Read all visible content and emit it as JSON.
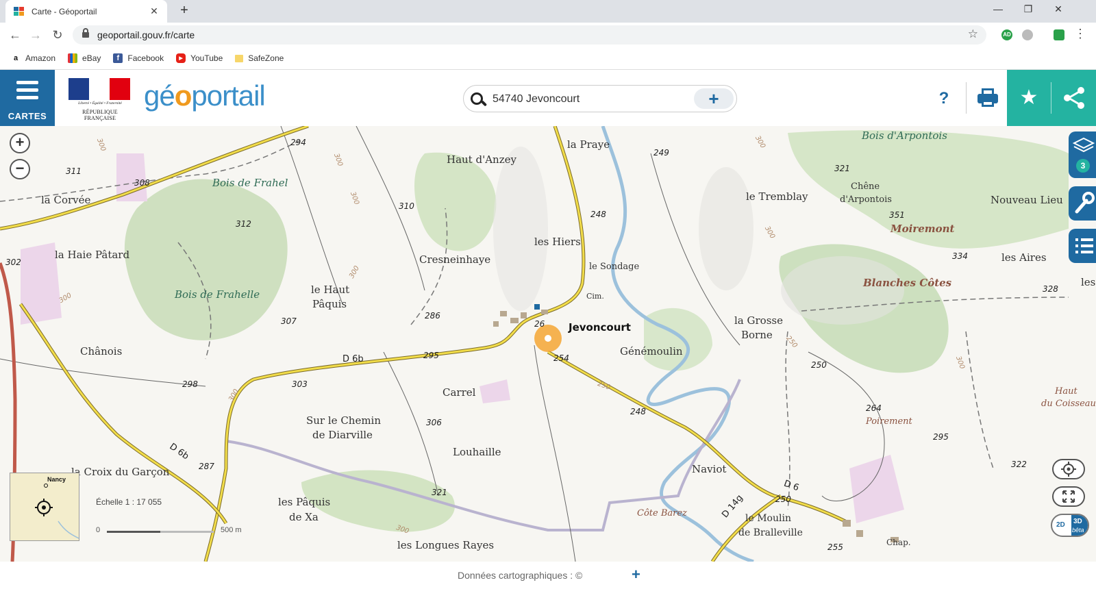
{
  "browser": {
    "tab_title": "Carte - Géoportail",
    "tab_close": "✕",
    "new_tab": "+",
    "url": "geoportail.gouv.fr/carte",
    "window_controls": {
      "minimize": "—",
      "maximize": "❐",
      "close": "✕"
    },
    "extensions": [
      "AD",
      "",
      ""
    ],
    "bookmarks": [
      {
        "label": "Amazon",
        "icon": "amazon-icon"
      },
      {
        "label": "eBay",
        "icon": "ebay-icon"
      },
      {
        "label": "Facebook",
        "icon": "facebook-icon"
      },
      {
        "label": "YouTube",
        "icon": "youtube-icon"
      },
      {
        "label": "SafeZone",
        "icon": "folder-icon"
      }
    ]
  },
  "header": {
    "menu_label": "CARTES",
    "rf_motto": "Liberté • Égalité • Fraternité",
    "rf_name": "RÉPUBLIQUE FRANÇAISE",
    "logo": {
      "part1": "gé",
      "part2": "o",
      "part3": "portail"
    },
    "search_value": "54740 Jevoncourt",
    "search_add": "+",
    "help": "?",
    "colors": {
      "primary": "#1f6aa1",
      "accent": "#24b3a1",
      "logo_orange": "#f09a1e"
    }
  },
  "map": {
    "zoom_in": "+",
    "zoom_out": "−",
    "layers_count": "3",
    "minimap_label": "Nancy",
    "scale_text": "Échelle 1 : 17 055",
    "scale_min": "0",
    "scale_max": "500 m",
    "btn_2d": "2D",
    "btn_3d": "3D",
    "btn_beta": "bêta",
    "labels": {
      "places": [
        "la Praye",
        "Haut d'Anzey",
        "la Corvée",
        "la Haie Pâtard",
        "Cresneinhaye",
        "les Hiers",
        "le Sondage",
        "le Haut",
        "Pâquis",
        "Chânois",
        "Carrel",
        "Génémoulin",
        "la Grosse",
        "Borne",
        "le Tremblay",
        "Chêne",
        "d'Arpontois",
        "Nouveau Lieu",
        "les Aires",
        "les",
        "Sur le Chemin",
        "de Diarville",
        "Louhaille",
        "la Croix du Garçon",
        "les Pâquis",
        "de Xa",
        "les Longues Rayes",
        "Naviot",
        "le Moulin",
        "de Bralleville",
        "Cim.",
        "Chap."
      ],
      "town": "Jevoncourt",
      "forests": [
        "Bois de Frahel",
        "Bois de Frahelle",
        "Bois d'Arpontois"
      ],
      "hills": [
        "Moiremont",
        "Blanches Côtes"
      ],
      "sub_hills": [
        "Poirement",
        "Côte Barez",
        "Haut",
        "du Coisseau"
      ],
      "altitudes": [
        "294",
        "311",
        "308",
        "312",
        "310",
        "302",
        "307",
        "286",
        "298",
        "303",
        "295",
        "254",
        "248",
        "249",
        "248",
        "321",
        "351",
        "334",
        "328",
        "250",
        "264",
        "295",
        "322",
        "306",
        "287",
        "321",
        "250",
        "255",
        "26"
      ],
      "roads": [
        "D 6b",
        "D 6b",
        "D 6",
        "D 14g"
      ],
      "contours": [
        "300",
        "300",
        "300",
        "300",
        "300",
        "300",
        "300",
        "300",
        "250",
        "250",
        "300",
        "300"
      ]
    }
  },
  "footer": {
    "text": "Données cartographiques : ©",
    "plus": "+"
  }
}
